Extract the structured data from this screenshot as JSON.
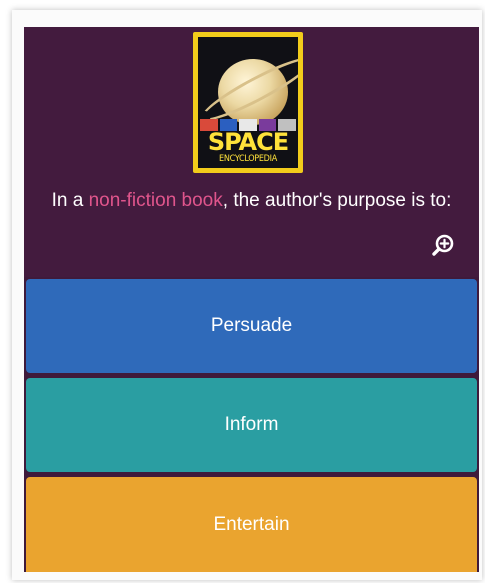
{
  "book": {
    "title": "SPACE",
    "subtitle": "ENCYCLOPEDIA"
  },
  "question": {
    "prefix": "In a ",
    "highlight": "non-fiction book",
    "suffix": ", the author's purpose is to:"
  },
  "answers": [
    {
      "label": "Persuade",
      "color": "#2f6aba"
    },
    {
      "label": "Inform",
      "color": "#2a9ea2"
    },
    {
      "label": "Entertain",
      "color": "#eaa42f"
    }
  ],
  "icons": {
    "zoom": "zoom-in-icon"
  },
  "colors": {
    "card_background": "#431b3e",
    "highlight": "#e0558c",
    "book_border": "#f2cc1b"
  }
}
